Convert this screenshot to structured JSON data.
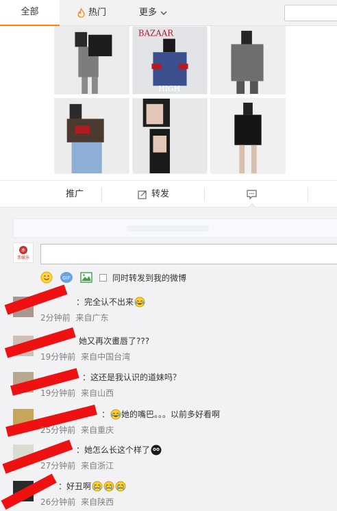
{
  "topbar": {
    "tab_all": "全部",
    "tab_hot": "热门",
    "tab_more": "更多",
    "accent": "#ff8200"
  },
  "photos": [
    {
      "icon": "fashion-photo"
    },
    {
      "icon": "magazine-cover-photo",
      "cover_title": "BAZAAR",
      "cover_text": "HIGH"
    },
    {
      "icon": "fashion-photo"
    },
    {
      "icon": "fashion-photo"
    },
    {
      "icon": "fashion-photo"
    },
    {
      "icon": "fashion-photo"
    }
  ],
  "actions": {
    "promote": "推广",
    "forward": "转发",
    "comment_icon": "comment-icon"
  },
  "compose": {
    "forward_checkbox_label": "同时转发到我的微博",
    "avatar_text": "赤娱乐"
  },
  "comments": [
    {
      "text": "：完全认不出来",
      "emoji": "laugh-cry",
      "time": "2分钟前",
      "source": "来自广东"
    },
    {
      "text": "她又再次畫唇了???",
      "emoji": "",
      "time": "19分钟前",
      "source": "来自中国台湾"
    },
    {
      "text": "：这还是我认识的道妹吗？",
      "emoji": "",
      "time": "19分钟前",
      "source": "来自山西"
    },
    {
      "text": "她的嘴巴。。。以前多好看啊",
      "emoji": "laugh-cry",
      "time": "25分钟前",
      "source": "来自重庆"
    },
    {
      "text": "：她怎么长这个样了",
      "emoji": "shocked",
      "time": "27分钟前",
      "source": "来自浙江"
    },
    {
      "text": "：好丑啊",
      "emoji": "crying-triple",
      "time": "26分钟前",
      "source": "来自陕西"
    }
  ],
  "colors": {
    "username": "#eb7350",
    "meta": "#808080",
    "redaction": "#ee1111",
    "comment_bg": "#f2f2f5"
  }
}
